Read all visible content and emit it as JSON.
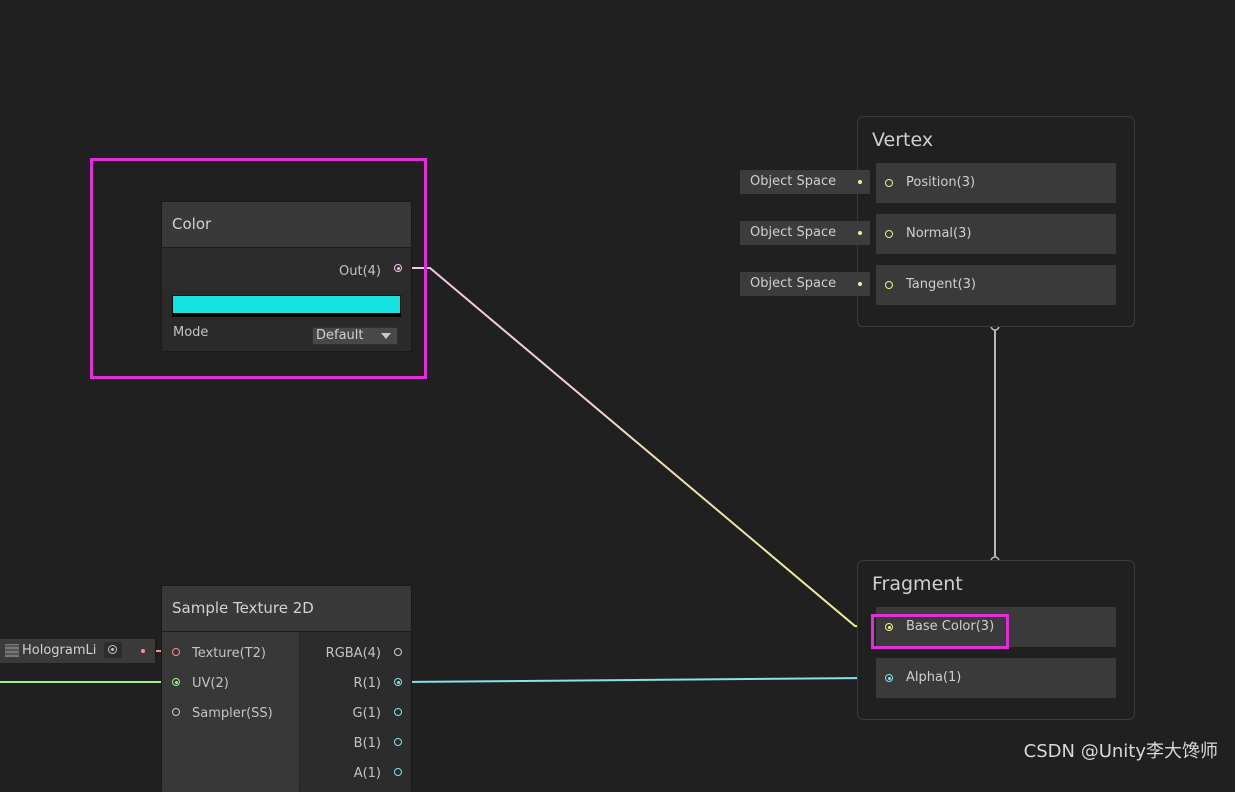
{
  "color_node": {
    "title": "Color",
    "out_port": "Out(4)",
    "swatch_color": "#16e0e0",
    "mode_label": "Mode",
    "mode_value": "Default"
  },
  "sample_node": {
    "title": "Sample Texture 2D",
    "inputs": [
      "Texture(T2)",
      "UV(2)",
      "Sampler(SS)"
    ],
    "outputs": [
      "RGBA(4)",
      "R(1)",
      "G(1)",
      "B(1)",
      "A(1)"
    ]
  },
  "texture_prop": {
    "label": "HologramLi"
  },
  "vertex": {
    "title": "Vertex",
    "slots": [
      "Position(3)",
      "Normal(3)",
      "Tangent(3)"
    ],
    "space_label": "Object Space"
  },
  "fragment": {
    "title": "Fragment",
    "slots": [
      "Base Color(3)",
      "Alpha(1)"
    ]
  },
  "watermark": "CSDN @Unity李大馋师",
  "colors": {
    "highlight": "#e02fd6",
    "vector3": "#f0f08c",
    "vector4": "#f0c8f0",
    "float": "#84e4e7",
    "texture": "#ff8b8b",
    "uv": "#a0ef92"
  }
}
